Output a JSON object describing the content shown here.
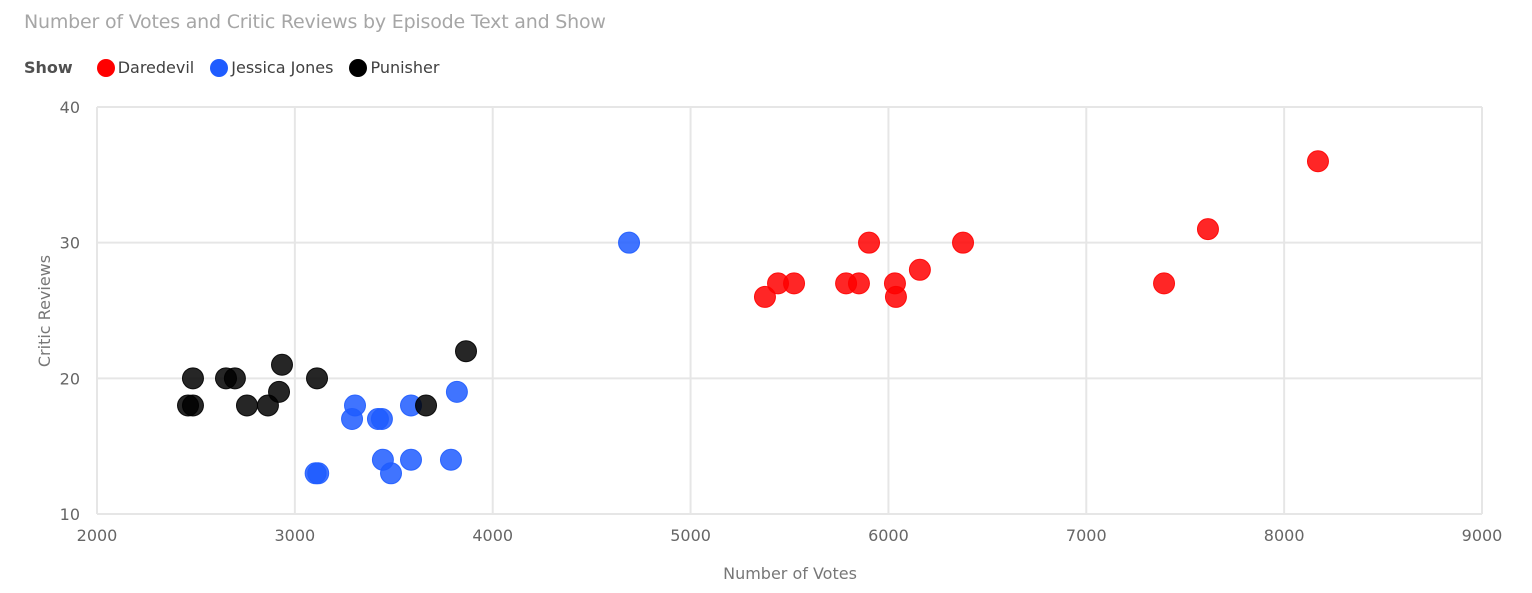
{
  "chart_data": {
    "type": "scatter",
    "title": "Number of Votes and Critic Reviews by Episode Text and Show",
    "xlabel": "Number of Votes",
    "ylabel": "Critic Reviews",
    "xlim": [
      2000,
      9000
    ],
    "ylim": [
      10,
      40
    ],
    "xticks": [
      "2000",
      "3000",
      "4000",
      "5000",
      "6000",
      "7000",
      "8000",
      "9000"
    ],
    "yticks": [
      "10",
      "20",
      "30",
      "40"
    ],
    "grid": true,
    "legend": {
      "title": "Show",
      "placement": "top-left",
      "entries": [
        "Daredevil",
        "Jessica Jones",
        "Punisher"
      ]
    },
    "series": [
      {
        "name": "Daredevil",
        "color": "#ff0000",
        "points": [
          {
            "x": 5376,
            "y": 26
          },
          {
            "x": 5442,
            "y": 27
          },
          {
            "x": 5523,
            "y": 27
          },
          {
            "x": 5786,
            "y": 27
          },
          {
            "x": 5851,
            "y": 27
          },
          {
            "x": 5902,
            "y": 30
          },
          {
            "x": 6033,
            "y": 27
          },
          {
            "x": 6038,
            "y": 26
          },
          {
            "x": 6159,
            "y": 28
          },
          {
            "x": 6377,
            "y": 30
          },
          {
            "x": 7393,
            "y": 27
          },
          {
            "x": 7615,
            "y": 31
          },
          {
            "x": 8171,
            "y": 36
          }
        ]
      },
      {
        "name": "Jessica Jones",
        "color": "#1f5cff",
        "points": [
          {
            "x": 3105,
            "y": 13
          },
          {
            "x": 3118,
            "y": 13
          },
          {
            "x": 3289,
            "y": 17
          },
          {
            "x": 3304,
            "y": 18
          },
          {
            "x": 3420,
            "y": 17
          },
          {
            "x": 3440,
            "y": 17
          },
          {
            "x": 3445,
            "y": 14
          },
          {
            "x": 3486,
            "y": 13
          },
          {
            "x": 3587,
            "y": 18
          },
          {
            "x": 3587,
            "y": 14
          },
          {
            "x": 3789,
            "y": 14
          },
          {
            "x": 3819,
            "y": 19
          },
          {
            "x": 4689,
            "y": 30
          }
        ]
      },
      {
        "name": "Punisher",
        "color": "#000000",
        "points": [
          {
            "x": 2460,
            "y": 18
          },
          {
            "x": 2485,
            "y": 18
          },
          {
            "x": 2485,
            "y": 20
          },
          {
            "x": 2652,
            "y": 20
          },
          {
            "x": 2697,
            "y": 20
          },
          {
            "x": 2758,
            "y": 18
          },
          {
            "x": 2864,
            "y": 18
          },
          {
            "x": 2920,
            "y": 19
          },
          {
            "x": 2935,
            "y": 21
          },
          {
            "x": 3112,
            "y": 20
          },
          {
            "x": 3663,
            "y": 18
          },
          {
            "x": 3865,
            "y": 22
          }
        ]
      }
    ]
  }
}
